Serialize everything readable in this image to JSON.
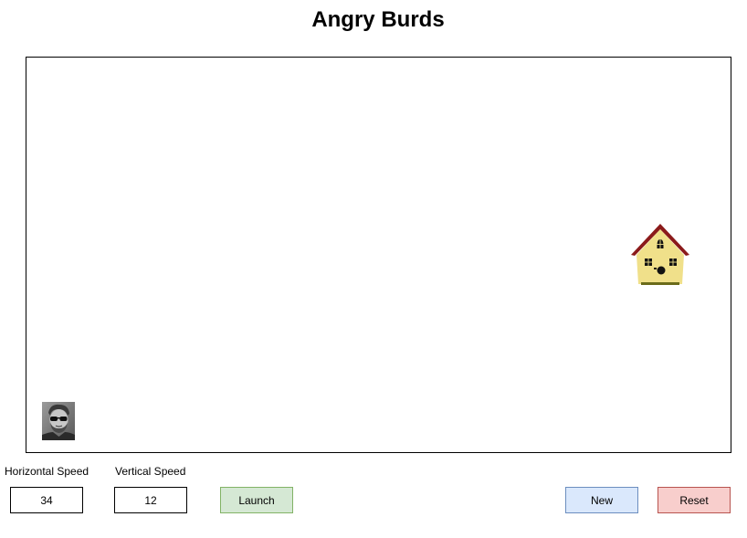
{
  "title": "Angry Burds",
  "controls": {
    "horizontal_speed": {
      "label": "Horizontal Speed",
      "value": "34"
    },
    "vertical_speed": {
      "label": "Vertical Speed",
      "value": "12"
    },
    "launch_label": "Launch",
    "new_label": "New",
    "reset_label": "Reset"
  },
  "icons": {
    "player": "player-avatar-icon",
    "target": "birdhouse-icon"
  },
  "colors": {
    "launch_fill": "#d5e8d4",
    "launch_border": "#82b366",
    "new_fill": "#dae8fc",
    "new_border": "#6c8ebf",
    "reset_fill": "#f8cecc",
    "reset_border": "#b85450",
    "house_body": "#f0e08a",
    "house_roof": "#8b1a1a"
  }
}
